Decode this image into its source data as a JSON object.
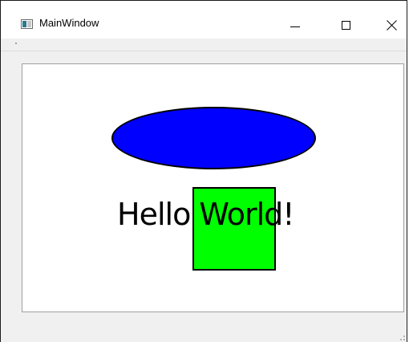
{
  "window": {
    "title": "MainWindow",
    "controls": {
      "minimize": "minimize",
      "maximize": "maximize",
      "close": "close"
    }
  },
  "scene": {
    "text": "Hello World!",
    "ellipse_color": "#0000ff",
    "rect_color": "#00ff00",
    "outline_color": "#000000"
  }
}
